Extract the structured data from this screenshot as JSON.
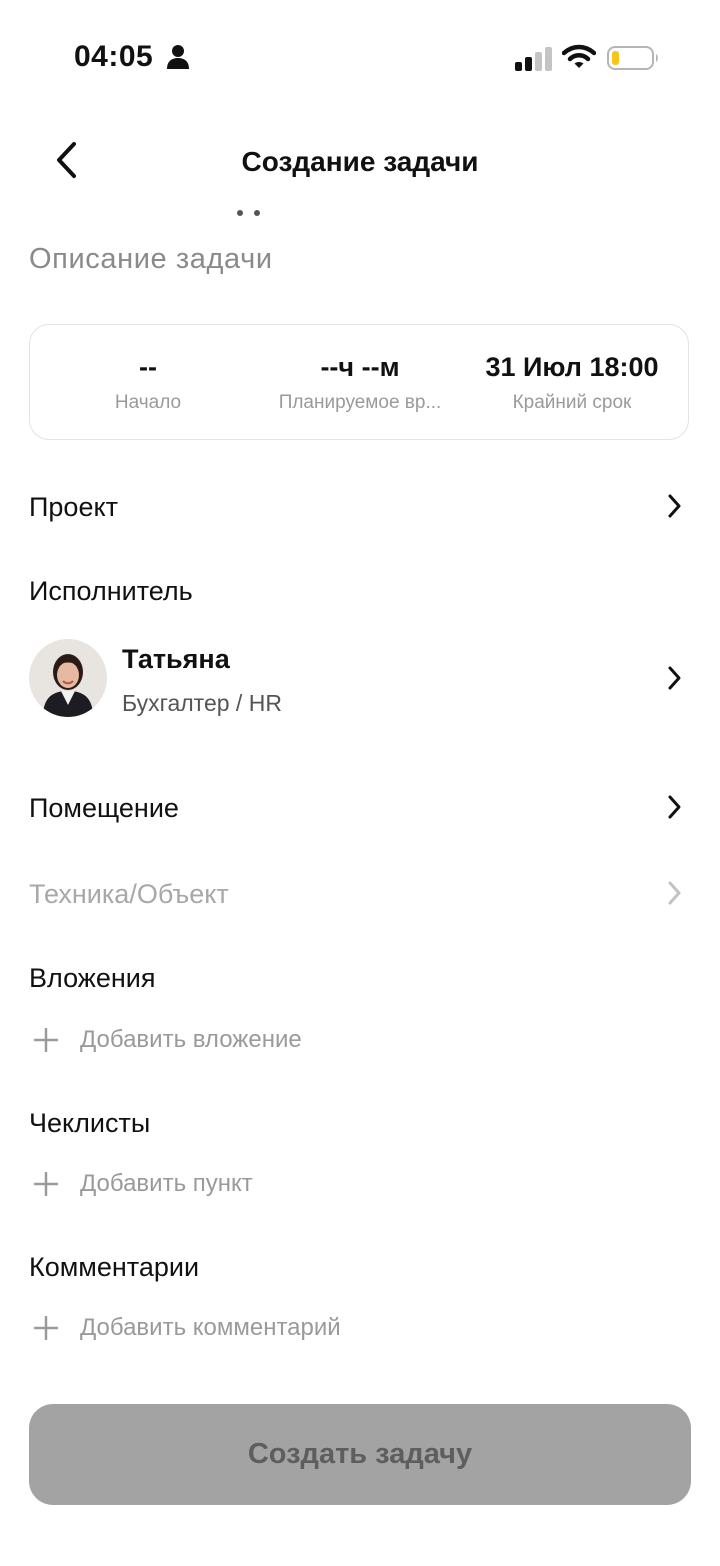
{
  "status_bar": {
    "time": "04:05",
    "battery_color": "#f5c518"
  },
  "header": {
    "title": "Создание задачи"
  },
  "description": {
    "placeholder": "Описание задачи"
  },
  "time_card": [
    {
      "value": "--",
      "label": "Начало"
    },
    {
      "value": "--ч --м",
      "label": "Планируемое вр..."
    },
    {
      "value": "31 Июл 18:00",
      "label": "Крайний срок"
    }
  ],
  "project": {
    "label": "Проект"
  },
  "assignee": {
    "section_label": "Исполнитель",
    "name": "Татьяна",
    "role": "Бухгалтер / HR"
  },
  "room": {
    "label": "Помещение"
  },
  "equipment": {
    "label": "Техника/Объект"
  },
  "attachments": {
    "section_label": "Вложения",
    "add_label": "Добавить вложение"
  },
  "checklists": {
    "section_label": "Чеклисты",
    "add_label": "Добавить пункт"
  },
  "comments": {
    "section_label": "Комментарии",
    "add_label": "Добавить комментарий"
  },
  "create_button": {
    "label": "Создать задачу"
  },
  "icons": {
    "back": "chevron-left-icon",
    "row": "chevron-right-icon",
    "add": "plus-icon"
  }
}
